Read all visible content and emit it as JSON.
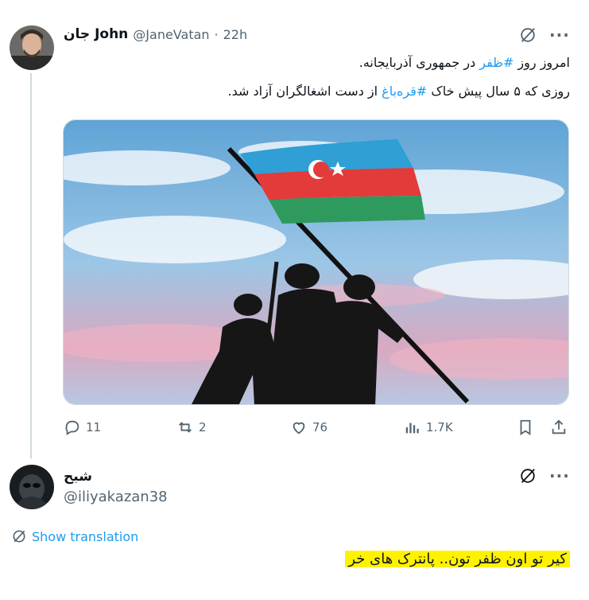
{
  "tweet": {
    "display_name_fa": "جان",
    "display_name_en": "John",
    "handle": "@JaneVatan",
    "separator": "·",
    "time": "22h",
    "line1_pre": "امروز روز ",
    "line1_tag": "#ظفر",
    "line1_post": " در جمهوری آذربایجانه.",
    "line2_pre": "روزی که ۵ سال پیش خاک ",
    "line2_tag": "#قره‌باغ",
    "line2_post": " از دست اشغالگران آزاد شد.",
    "actions": {
      "replies": "11",
      "retweets": "2",
      "likes": "76",
      "views": "1.7K"
    },
    "more_label": "···"
  },
  "reply": {
    "display_name": "شبح",
    "handle": "@iliyakazan38",
    "show_translation": "Show translation",
    "text": "کیر تو اون ظفر تون.. پانترک های خر",
    "highlight_color": "#fff200",
    "more_label": "···"
  },
  "colors": {
    "accent": "#1d9bf0",
    "muted": "#536471",
    "line": "#cfd9de"
  }
}
